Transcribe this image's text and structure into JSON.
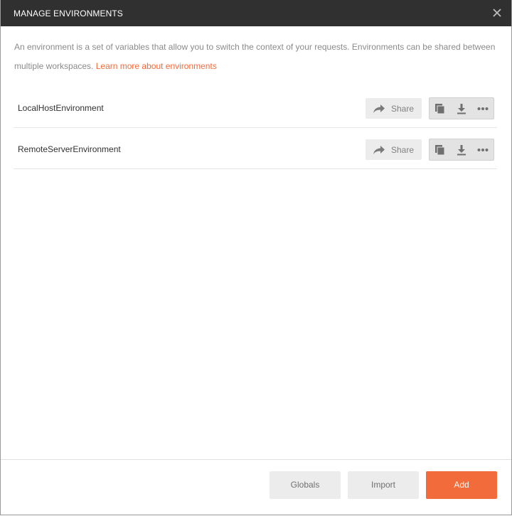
{
  "dialog": {
    "title": "MANAGE ENVIRONMENTS"
  },
  "intro": {
    "text": "An environment is a set of variables that allow you to switch the context of your requests. Environments can be shared between multiple workspaces.",
    "link_label": "Learn more about environments"
  },
  "environments": [
    {
      "name": "LocalHostEnvironment",
      "share_label": "Share"
    },
    {
      "name": "RemoteServerEnvironment",
      "share_label": "Share"
    }
  ],
  "icons": {
    "close": "close-icon",
    "share": "share-arrow-icon",
    "duplicate": "duplicate-icon",
    "download": "download-icon",
    "more": "more-dots-icon"
  },
  "footer": {
    "globals_label": "Globals",
    "import_label": "Import",
    "add_label": "Add"
  },
  "colors": {
    "header_bg": "#303030",
    "accent": "#f26b3a",
    "button_bg": "#ececec"
  }
}
